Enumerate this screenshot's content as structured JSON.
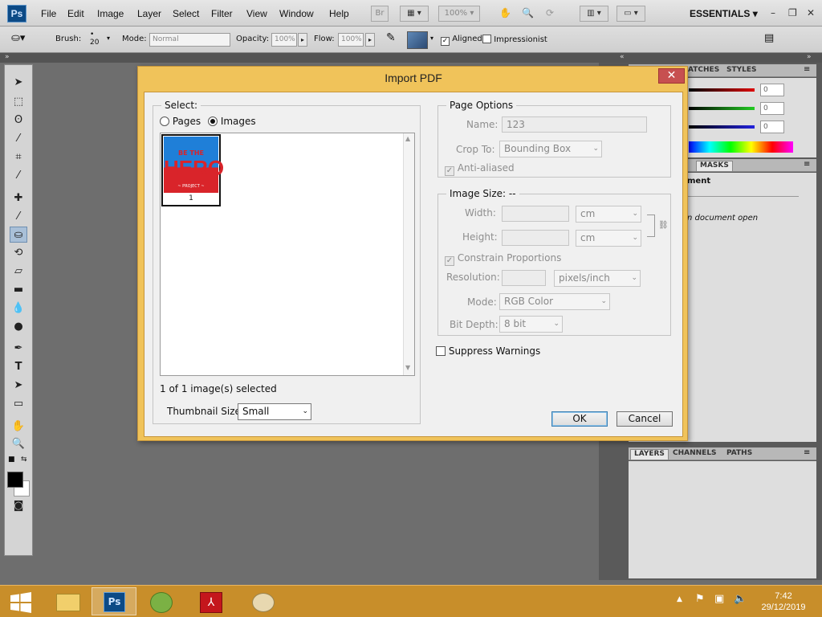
{
  "app": {
    "logo": "Ps"
  },
  "menu": [
    "File",
    "Edit",
    "Image",
    "Layer",
    "Select",
    "Filter",
    "View",
    "Window",
    "Help"
  ],
  "appbar": {
    "br_label": "Br",
    "zoom": "100%",
    "workspace": "ESSENTIALS"
  },
  "options": {
    "brush_label": "Brush:",
    "brush_size": "20",
    "mode_label": "Mode:",
    "mode_value": "Normal",
    "opacity_label": "Opacity:",
    "opacity_value": "100%",
    "flow_label": "Flow:",
    "flow_value": "100%",
    "aligned_label": "Aligned",
    "aligned_checked": true,
    "impressionist_label": "Impressionist",
    "impressionist_checked": false
  },
  "panels": {
    "top_tabs": [
      "ATCHES",
      "STYLES"
    ],
    "slider_values": [
      "0",
      "0",
      "0"
    ],
    "mid_tabs": [
      "S",
      "MASKS"
    ],
    "mid_heading": "ment",
    "mid_message": "n document open",
    "bottom_tabs": [
      "LAYERS",
      "CHANNELS",
      "PATHS"
    ]
  },
  "dialog": {
    "title": "Import PDF",
    "close": "✕",
    "select_label": "Select:",
    "pages_label": "Pages",
    "images_label": "Images",
    "selected_option": "Images",
    "thumbnail": {
      "line1": "BE THE",
      "line2": "HERO",
      "line3": "~ PROJECT ~",
      "number": "1"
    },
    "status": "1 of 1 image(s) selected",
    "thumb_size_label": "Thumbnail Size:",
    "thumb_size_value": "Small",
    "page_options": {
      "title": "Page Options",
      "name_label": "Name:",
      "name_value": "123",
      "crop_label": "Crop To:",
      "crop_value": "Bounding Box",
      "antialiased_label": "Anti-aliased"
    },
    "image_size": {
      "title": "Image Size: --",
      "width_label": "Width:",
      "width_unit": "cm",
      "height_label": "Height:",
      "height_unit": "cm",
      "constrain_label": "Constrain Proportions",
      "resolution_label": "Resolution:",
      "resolution_unit": "pixels/inch",
      "mode_label": "Mode:",
      "mode_value": "RGB Color",
      "bitdepth_label": "Bit Depth:",
      "bitdepth_value": "8 bit"
    },
    "suppress_label": "Suppress Warnings",
    "ok": "OK",
    "cancel": "Cancel"
  },
  "clock": {
    "time": "7:42",
    "date": "29/12/2019"
  },
  "colors": {
    "accent": "#f0c35a",
    "taskbar": "#c88e2a",
    "close": "#c75050"
  }
}
